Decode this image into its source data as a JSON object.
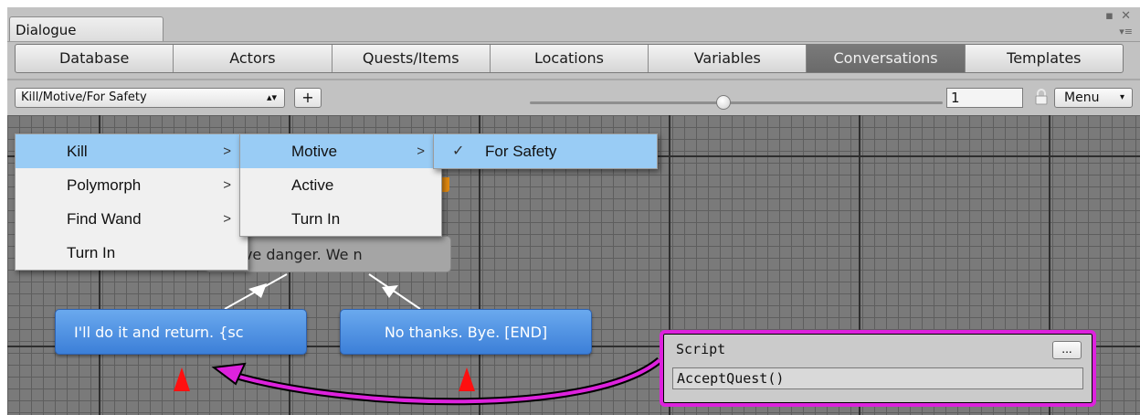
{
  "window": {
    "title": "Dialogue",
    "controls": "▪ ✕",
    "tab_menu": "▾≡"
  },
  "toolbar": {
    "tabs": [
      "Database",
      "Actors",
      "Quests/Items",
      "Locations",
      "Variables",
      "Conversations",
      "Templates"
    ],
    "active": "Conversations"
  },
  "conversation_bar": {
    "selected": "Kill/Motive/For Safety",
    "add_label": "+",
    "zoom_value": "1",
    "menu_label": "Menu"
  },
  "canvas": {
    "npc_node_text": "s grave danger. We n",
    "accept_node_text": "I'll do it and return. {sc",
    "decline_node_text": "No thanks. Bye. [END]"
  },
  "script_popup": {
    "label": "Script",
    "dots": "...",
    "value": "AcceptQuest()"
  },
  "menu": {
    "level1": [
      "Kill",
      "Polymorph",
      "Find Wand",
      "Turn In"
    ],
    "level2": [
      "Motive",
      "Active",
      "Turn In"
    ],
    "level3": [
      "For Safety"
    ],
    "submenu_arrow": ">",
    "check_mark": "✓"
  },
  "colors": {
    "accent_highlight": "#99ccf5",
    "node_blue": "#4a8fe0",
    "annotation_magenta": "#dd22dd",
    "active_tab": "#6f6f6f"
  }
}
